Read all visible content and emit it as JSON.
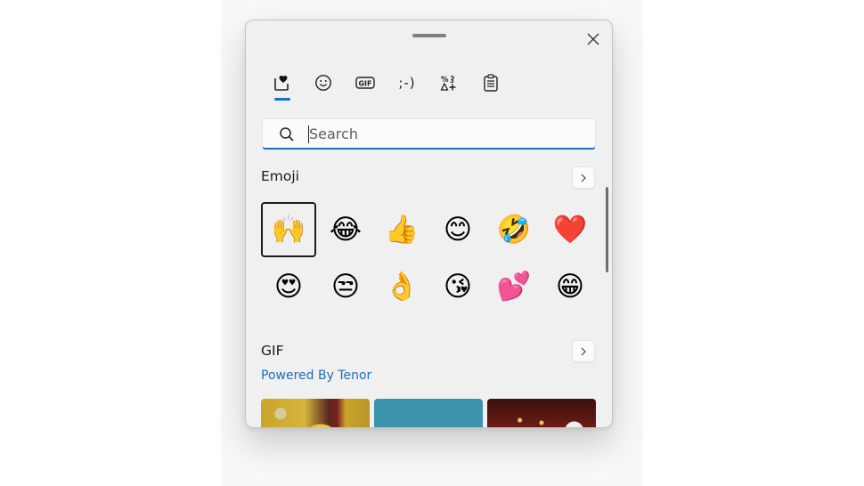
{
  "panel": {
    "close_label": "Close"
  },
  "tabs": [
    {
      "name": "most-recently-used",
      "icon": "heart-square-icon",
      "selected": true
    },
    {
      "name": "emoji",
      "icon": "smiley-icon",
      "selected": false
    },
    {
      "name": "gif",
      "icon": "gif-icon",
      "label": "GIF",
      "selected": false
    },
    {
      "name": "kaomoji",
      "icon": "kaomoji-icon",
      "label": ";-)",
      "selected": false
    },
    {
      "name": "symbols",
      "icon": "symbols-icon",
      "selected": false
    },
    {
      "name": "clipboard-history",
      "icon": "clipboard-icon",
      "selected": false
    }
  ],
  "search": {
    "placeholder": "Search",
    "value": ""
  },
  "emoji_section": {
    "title": "Emoji",
    "items": [
      {
        "glyph": "🙌",
        "name": "raising-hands",
        "selected": true
      },
      {
        "glyph": "😂",
        "name": "face-with-tears-of-joy",
        "selected": false
      },
      {
        "glyph": "👍",
        "name": "thumbs-up",
        "selected": false
      },
      {
        "glyph": "😊",
        "name": "smiling-face-with-smiling-eyes",
        "selected": false
      },
      {
        "glyph": "🤣",
        "name": "rolling-on-the-floor-laughing",
        "selected": false
      },
      {
        "glyph": "❤️",
        "name": "red-heart",
        "selected": false
      },
      {
        "glyph": "😍",
        "name": "smiling-face-with-heart-eyes",
        "selected": false
      },
      {
        "glyph": "😒",
        "name": "unamused-face",
        "selected": false
      },
      {
        "glyph": "👌",
        "name": "ok-hand",
        "selected": false
      },
      {
        "glyph": "😘",
        "name": "face-blowing-a-kiss",
        "selected": false
      },
      {
        "glyph": "💕",
        "name": "two-hearts",
        "selected": false
      },
      {
        "glyph": "😁",
        "name": "beaming-face-with-smiling-eyes",
        "selected": false
      }
    ]
  },
  "gif_section": {
    "title": "GIF",
    "powered_by": "Powered By Tenor",
    "thumbnails": [
      "minions",
      "blue-background-character",
      "theater-audience"
    ]
  },
  "colors": {
    "accent": "#1a6fc4",
    "panel_bg": "#f0f0f0"
  }
}
